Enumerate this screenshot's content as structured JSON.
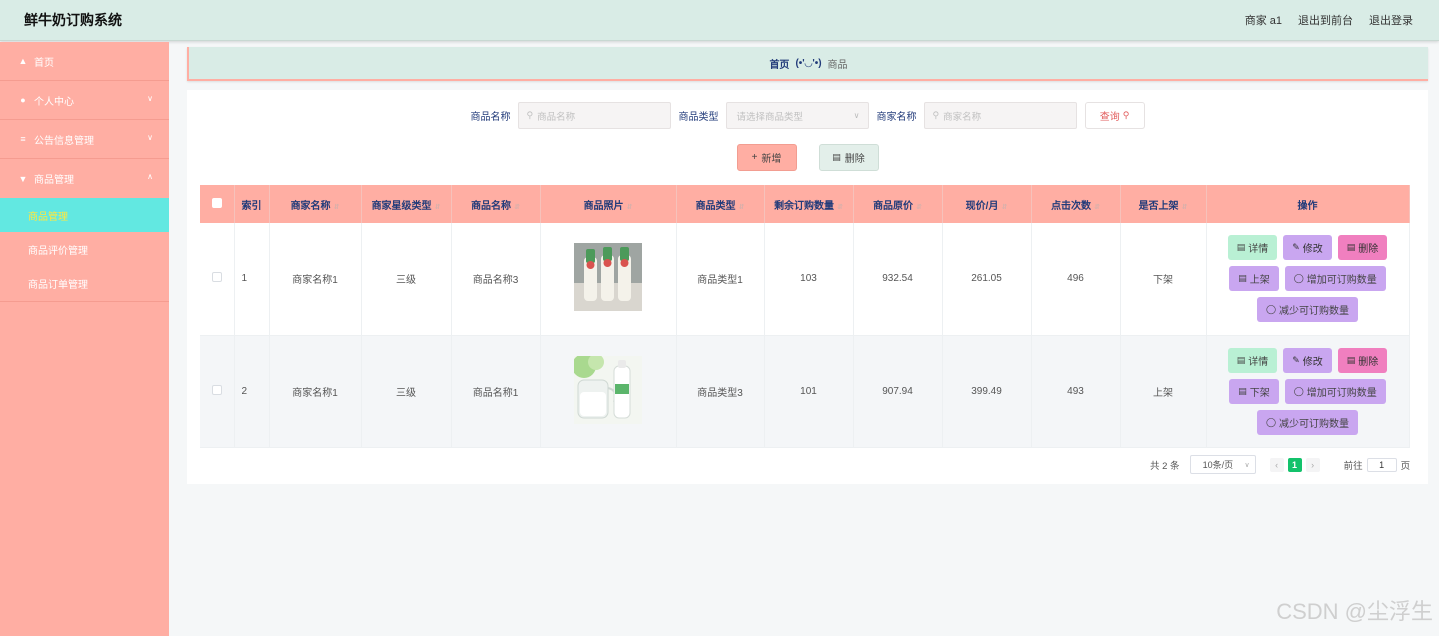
{
  "header": {
    "title": "鲜牛奶订购系统",
    "user": "商家 a1",
    "front": "退出到前台",
    "logout": "退出登录"
  },
  "sidebar": {
    "items": [
      {
        "label": "首页",
        "icon": "home-icon"
      },
      {
        "label": "个人中心",
        "icon": "user-icon"
      },
      {
        "label": "公告信息管理",
        "icon": "menu-icon"
      },
      {
        "label": "商品管理",
        "icon": "trophy-icon"
      }
    ],
    "sub": [
      {
        "label": "商品管理",
        "active": true
      },
      {
        "label": "商品评价管理"
      },
      {
        "label": "商品订单管理"
      }
    ]
  },
  "breadcrumb": {
    "home": "首页",
    "sep": "(•'◡'•)",
    "current": "商品"
  },
  "search": {
    "name_label": "商品名称",
    "name_placeholder": "商品名称",
    "type_label": "商品类型",
    "type_placeholder": "请选择商品类型",
    "shop_label": "商家名称",
    "shop_placeholder": "商家名称",
    "query": "查询"
  },
  "actions": {
    "add": "新增",
    "delete": "删除"
  },
  "table": {
    "columns": [
      "索引",
      "商家名称",
      "商家星级类型",
      "商品名称",
      "商品照片",
      "商品类型",
      "剩余订购数量",
      "商品原价",
      "现价/月",
      "点击次数",
      "是否上架",
      "操作"
    ],
    "rows": [
      {
        "index": "1",
        "shop": "商家名称1",
        "star": "三级",
        "name": "商品名称3",
        "type": "商品类型1",
        "remaining": "103",
        "price": "932.54",
        "current": "261.05",
        "clicks": "496",
        "status": "下架",
        "shelf_op": "上架"
      },
      {
        "index": "2",
        "shop": "商家名称1",
        "star": "三级",
        "name": "商品名称1",
        "type": "商品类型3",
        "remaining": "101",
        "price": "907.94",
        "current": "399.49",
        "clicks": "493",
        "status": "上架",
        "shelf_op": "下架"
      }
    ],
    "ops": {
      "detail": "详情",
      "edit": "修改",
      "remove": "删除",
      "inc": "增加可订购数量",
      "dec": "减少可订购数量"
    }
  },
  "pager": {
    "total": "共 2 条",
    "size": "10条/页",
    "page": "1",
    "goto": "前往",
    "goto_value": "1",
    "page_unit": "页"
  },
  "watermark": "CSDN @尘浮生"
}
